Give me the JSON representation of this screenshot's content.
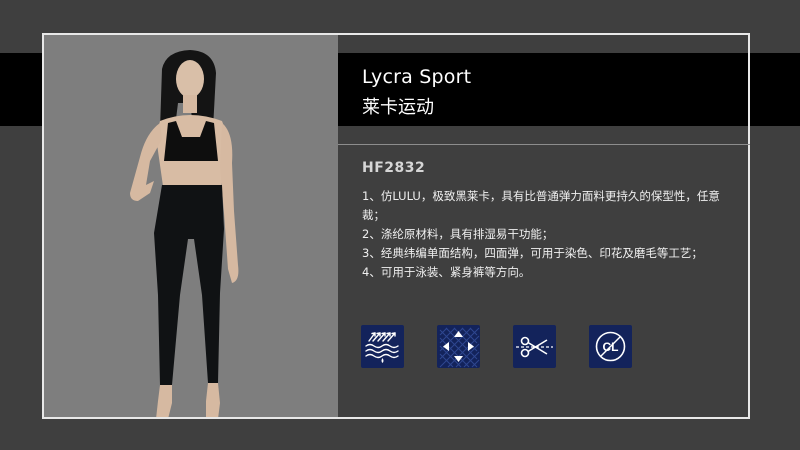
{
  "title_en": "Lycra Sport",
  "title_cn": "莱卡运动",
  "product_code": "HF2832",
  "features": [
    "1、仿LULU，极致黑莱卡，具有比普通弹力面料更持久的保型性，任意裁；",
    "2、涤纶原材料，具有排湿易干功能；",
    "3、经典纬编单面结构，四面弹，可用于染色、印花及磨毛等工艺；",
    "4、可用于泳装、紧身裤等方向。"
  ],
  "icons": [
    "moisture-wicking-icon",
    "four-way-stretch-icon",
    "cut-freely-icon",
    "cl-icon"
  ],
  "colors": {
    "background": "#3f3f3f",
    "band": "#000000",
    "photo_bg": "#7e7e7e",
    "icon_bg": "#13235b"
  }
}
